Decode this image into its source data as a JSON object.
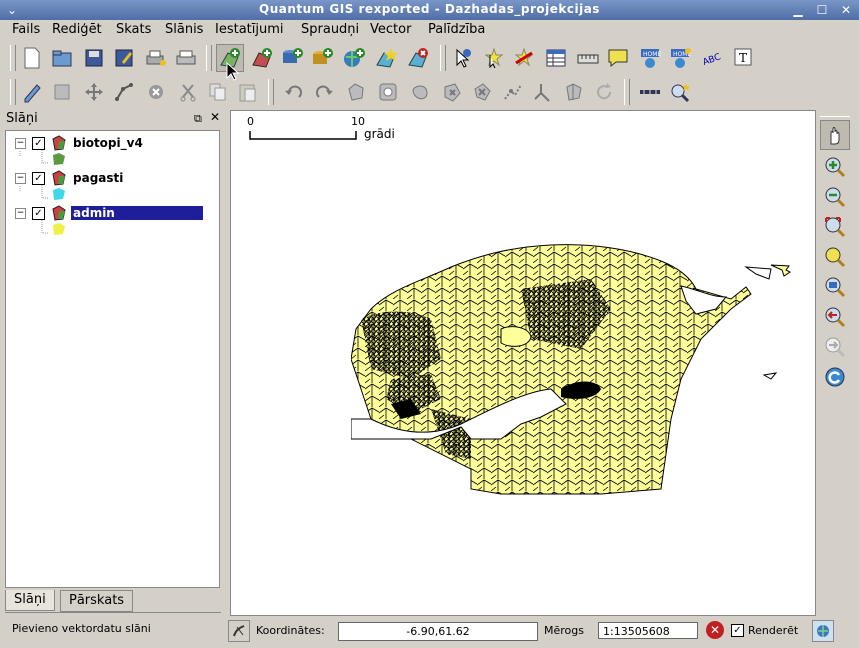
{
  "window": {
    "title": "Quantum GIS rexported - Dazhadas_projekcijas"
  },
  "menu": [
    "Fails",
    "Rediģēt",
    "Skats",
    "Slānis",
    "Iestatījumi",
    "Spraudņi",
    "Vector",
    "Palīdzība"
  ],
  "layers_panel": {
    "title": "Slāņi",
    "layers": [
      {
        "name": "biotopi_v4",
        "checked": true,
        "selected": false,
        "legend_color": "#5a9a40"
      },
      {
        "name": "pagasti",
        "checked": true,
        "selected": false,
        "legend_color": "#40d8e8"
      },
      {
        "name": "admin",
        "checked": true,
        "selected": true,
        "legend_color": "#f0f048"
      }
    ],
    "tabs": [
      "Slāņi",
      "Pārskats"
    ]
  },
  "map": {
    "scalebar": {
      "zero": "0",
      "max": "10",
      "unit": "grādi"
    },
    "fill_color": "#ffff99"
  },
  "status": {
    "message": "Pievieno vektordatu slāni",
    "coord_label": "Koordinātes:",
    "coord_value": "-6.90,61.62",
    "scale_label": "Mērogs",
    "scale_value": "1:13505608",
    "render_label": "Renderēt",
    "render_checked": true
  }
}
